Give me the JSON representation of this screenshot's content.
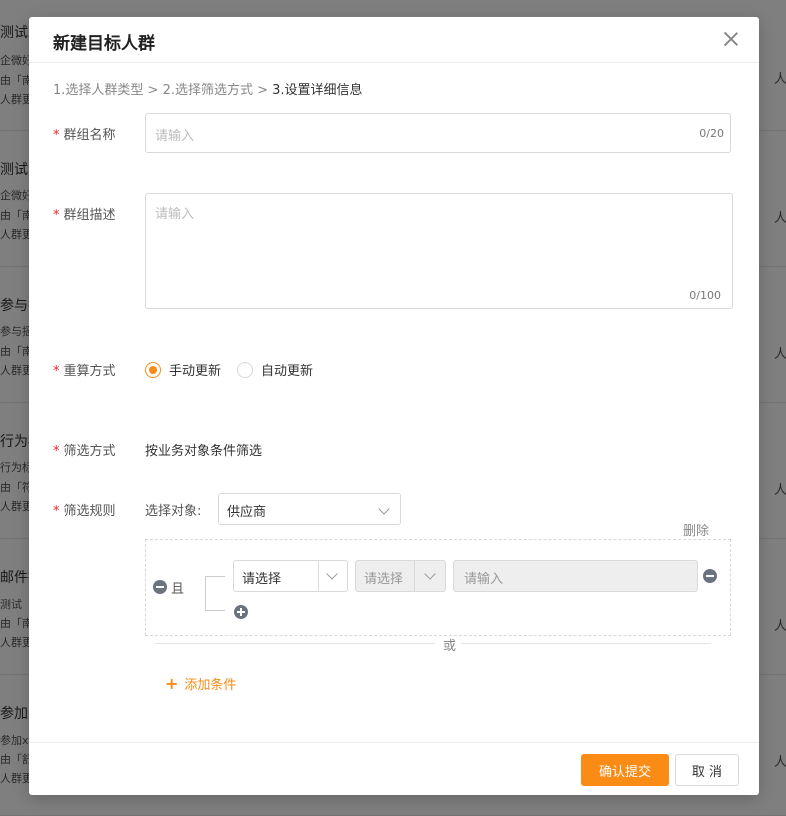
{
  "background": {
    "items": [
      {
        "title": "测试人",
        "line1": "企微好",
        "line2": "由「南",
        "line3": "人群更",
        "right": "人"
      },
      {
        "title": "测试人",
        "line1": "企微好",
        "line2": "由「南",
        "line3": "人群更",
        "right": "人"
      },
      {
        "title": "参与摇",
        "line1": "参与摇",
        "line2": "由「南",
        "line3": "人群更",
        "right": "人"
      },
      {
        "title": "行为标",
        "line1": "行为标",
        "line2": "由「符",
        "line3": "人群更",
        "right": "人"
      },
      {
        "title": "邮件推",
        "line1": "测试",
        "line2": "由「南",
        "line3": "人群更",
        "right": "人"
      },
      {
        "title": "参加x",
        "line1": "参加x",
        "line2": "由「舒",
        "line3": "人群更",
        "right": "人"
      }
    ]
  },
  "modal": {
    "title": "新建目标人群",
    "steps": {
      "step1": "1.选择人群类型",
      "sep1": " > ",
      "step2": "2.选择筛选方式",
      "sep2": " > ",
      "step3": "3.设置详细信息"
    },
    "required_mark": "*",
    "group_name": {
      "label": "群组名称",
      "placeholder": "请输入",
      "counter": "0/20"
    },
    "group_desc": {
      "label": "群组描述",
      "placeholder": "请输入",
      "counter": "0/100"
    },
    "recalc": {
      "label": "重算方式",
      "options": [
        "手动更新",
        "自动更新"
      ],
      "selected": "手动更新"
    },
    "filter_method": {
      "label": "筛选方式",
      "value": "按业务对象条件筛选"
    },
    "filter_rule": {
      "label": "筛选规则",
      "object_label": "选择对象:",
      "object_value": "供应商",
      "delete_label": "删除",
      "and_label": "且",
      "field_select": "请选择",
      "operator_select": "请选择",
      "value_placeholder": "请输入",
      "or_label": "或",
      "add_condition": "添加条件"
    },
    "footer": {
      "confirm": "确认提交",
      "cancel": "取 消"
    }
  },
  "colors": {
    "accent": "#fa8c16",
    "required": "#f5222d",
    "icon": "#6b7280"
  }
}
